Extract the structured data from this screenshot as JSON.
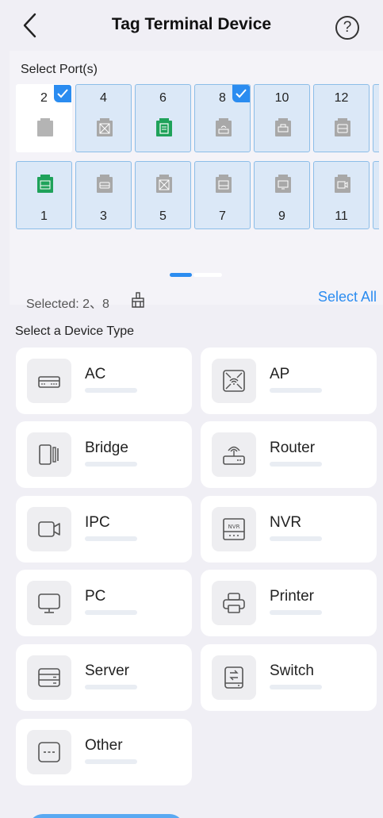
{
  "header": {
    "title": "Tag Terminal Device",
    "help_icon": "?"
  },
  "ports": {
    "section_label": "Select Port(s)",
    "top_row": [
      {
        "num": "2",
        "selected": true,
        "icon": "port-icon",
        "color": "plain"
      },
      {
        "num": "4",
        "selected": false,
        "icon": "ap-icon",
        "color": "gray"
      },
      {
        "num": "6",
        "selected": false,
        "icon": "switch-icon",
        "color": "green"
      },
      {
        "num": "8",
        "selected": true,
        "icon": "router-icon",
        "color": "gray"
      },
      {
        "num": "10",
        "selected": false,
        "icon": "printer-icon",
        "color": "gray"
      },
      {
        "num": "12",
        "selected": false,
        "icon": "server-icon",
        "color": "gray"
      }
    ],
    "bottom_row": [
      {
        "num": "1",
        "selected": false,
        "icon": "nvr-icon",
        "color": "green"
      },
      {
        "num": "3",
        "selected": false,
        "icon": "ac-icon",
        "color": "gray"
      },
      {
        "num": "5",
        "selected": false,
        "icon": "ap-icon",
        "color": "gray"
      },
      {
        "num": "7",
        "selected": false,
        "icon": "nvr-icon",
        "color": "gray"
      },
      {
        "num": "9",
        "selected": false,
        "icon": "pc-icon",
        "color": "gray"
      },
      {
        "num": "11",
        "selected": false,
        "icon": "ipc-icon",
        "color": "gray"
      }
    ],
    "pager": {
      "pages": 2,
      "current": 1
    }
  },
  "selection": {
    "selected_text": "Selected: 2、8",
    "select_all_label": "Select All"
  },
  "device_types": {
    "section_label": "Select a Device Type",
    "items": [
      {
        "label": "AC",
        "icon": "ac-icon"
      },
      {
        "label": "AP",
        "icon": "ap-icon"
      },
      {
        "label": "Bridge",
        "icon": "bridge-icon"
      },
      {
        "label": "Router",
        "icon": "router-icon"
      },
      {
        "label": "IPC",
        "icon": "ipc-icon"
      },
      {
        "label": "NVR",
        "icon": "nvr-icon"
      },
      {
        "label": "PC",
        "icon": "pc-icon"
      },
      {
        "label": "Printer",
        "icon": "printer-icon"
      },
      {
        "label": "Server",
        "icon": "server-icon"
      },
      {
        "label": "Switch",
        "icon": "switch-icon"
      },
      {
        "label": "Other",
        "icon": "other-icon"
      }
    ]
  },
  "colors": {
    "accent": "#2b8cf0",
    "port_green": "#1fa25a",
    "port_bg": "#dbe8f7",
    "background": "#f0eff5"
  }
}
